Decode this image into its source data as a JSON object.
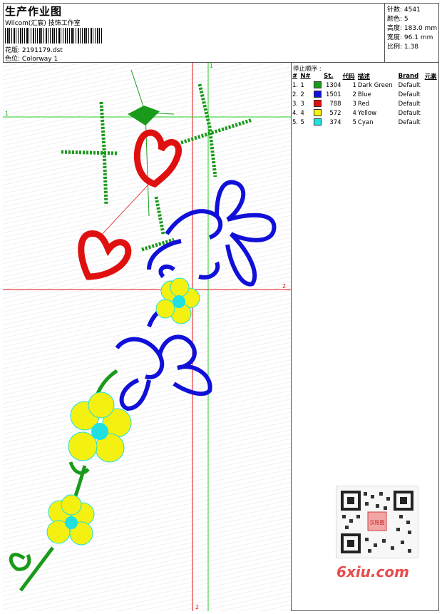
{
  "header": {
    "title": "生产作业图",
    "studio": "Wilcom(汇宸) 技饰工作室",
    "design_label": "花版:",
    "design_value": "2191179.dst",
    "colorway_label": "色位:",
    "colorway_value": "Colorway 1"
  },
  "stats": {
    "stitches_label": "针数:",
    "stitches": "4541",
    "colors_label": "颜色:",
    "colors": "5",
    "height_label": "高度:",
    "height": "183.0 mm",
    "width_label": "宽度:",
    "width": "96.1 mm",
    "scale_label": "比例:",
    "scale": "1.38"
  },
  "stop_sequence": {
    "title": "停止顺序 :",
    "columns": [
      "#",
      "N#",
      "St.",
      "代码",
      "描述",
      "Brand",
      "元素"
    ],
    "rows": [
      {
        "idx": "1.",
        "n": "1",
        "color": "#1a9a1a",
        "stitches": "1304",
        "code": "1",
        "desc": "Dark Green",
        "brand": "Default"
      },
      {
        "idx": "2.",
        "n": "2",
        "color": "#1010d8",
        "stitches": "1501",
        "code": "2",
        "desc": "Blue",
        "brand": "Default"
      },
      {
        "idx": "3.",
        "n": "3",
        "color": "#e01010",
        "stitches": "788",
        "code": "3",
        "desc": "Red",
        "brand": "Default"
      },
      {
        "idx": "4.",
        "n": "4",
        "color": "#f4f010",
        "stitches": "572",
        "code": "4",
        "desc": "Yellow",
        "brand": "Default"
      },
      {
        "idx": "5.",
        "n": "5",
        "color": "#20e0e0",
        "stitches": "374",
        "code": "5",
        "desc": "Cyan",
        "brand": "Default"
      }
    ]
  },
  "guides": {
    "v1": "1",
    "h1": "1",
    "v2": "2",
    "h2": "2"
  },
  "watermark": {
    "site": "6xiu.com",
    "seal": "汉阳图"
  },
  "palette": {
    "green": "#1a9a1a",
    "blue": "#1010d8",
    "red": "#e01010",
    "yellow": "#f4f010",
    "cyan": "#20e0e0",
    "guide_red": "#e01010",
    "guide_green": "#22cc22"
  }
}
